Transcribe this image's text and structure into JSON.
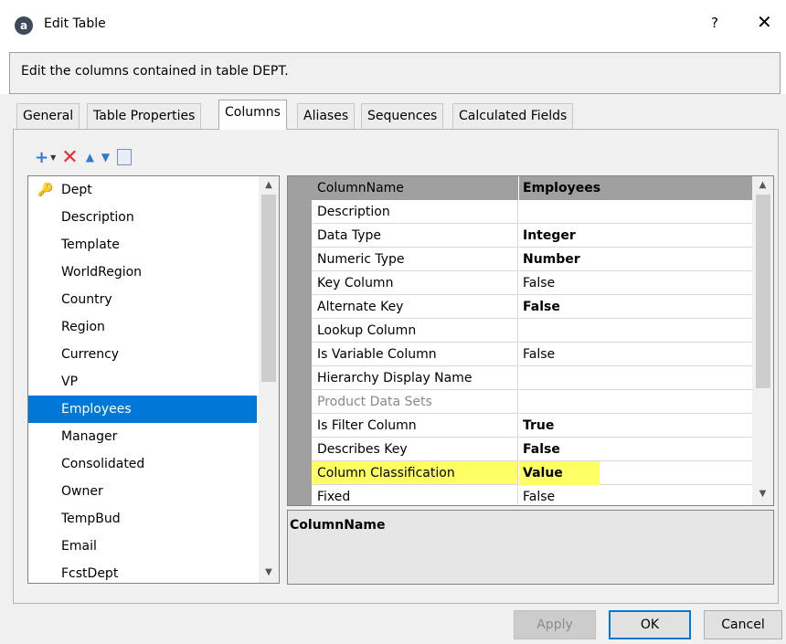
{
  "window": {
    "title": "Edit Table",
    "app_icon": "a",
    "help_label": "?",
    "close_label": "✕"
  },
  "description": "Edit the columns contained in table DEPT.",
  "tabs": [
    {
      "label": "General"
    },
    {
      "label": "Table Properties"
    },
    {
      "label": "Columns",
      "active": true
    },
    {
      "label": "Aliases"
    },
    {
      "label": "Sequences"
    },
    {
      "label": "Calculated Fields"
    }
  ],
  "toolbar": {
    "add_icon": "+",
    "dropdown_icon": "▼",
    "delete_icon": "✕",
    "up_icon": "▲",
    "down_icon": "▼"
  },
  "columns_list": {
    "selected": "Employees",
    "items": [
      "Dept",
      "Description",
      "Template",
      "WorldRegion",
      "Country",
      "Region",
      "Currency",
      "VP",
      "Employees",
      "Manager",
      "Consolidated",
      "Owner",
      "TempBud",
      "Email",
      "FcstDept"
    ],
    "key_icon": "🔑",
    "scroll_up": "▲",
    "scroll_down": "▼"
  },
  "properties": {
    "header": {
      "name": "ColumnName",
      "value": "Employees"
    },
    "rows": [
      {
        "name": "Description",
        "value": ""
      },
      {
        "name": "Data Type",
        "value": "Integer",
        "bold": true
      },
      {
        "name": "Numeric Type",
        "value": "Number",
        "bold": true
      },
      {
        "name": "Key Column",
        "value": "False"
      },
      {
        "name": "Alternate Key",
        "value": "False",
        "bold": true
      },
      {
        "name": "Lookup Column",
        "value": ""
      },
      {
        "name": "Is Variable Column",
        "value": "False"
      },
      {
        "name": "Hierarchy Display Name",
        "value": ""
      },
      {
        "name": "Product Data Sets",
        "value": "",
        "disabled": true
      },
      {
        "name": "Is Filter Column",
        "value": "True",
        "bold": true
      },
      {
        "name": "Describes Key",
        "value": "False",
        "bold": true
      },
      {
        "name": "Column Classification",
        "value": "Value",
        "bold": true,
        "highlight": true
      },
      {
        "name": "Fixed",
        "value": "False"
      }
    ],
    "scroll_up": "▲",
    "scroll_down": "▼"
  },
  "help_panel": {
    "title": "ColumnName"
  },
  "buttons": {
    "apply": "Apply",
    "ok": "OK",
    "cancel": "Cancel"
  }
}
